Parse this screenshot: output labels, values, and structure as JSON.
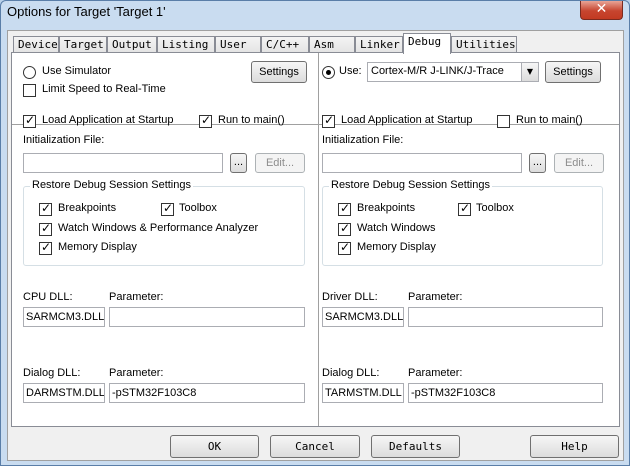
{
  "title": "Options for Target 'Target 1'",
  "close_glyph": "✕",
  "tabs": [
    "Device",
    "Target",
    "Output",
    "Listing",
    "User",
    "C/C++",
    "Asm",
    "Linker",
    "Debug",
    "Utilities"
  ],
  "active_tab": "Debug",
  "left": {
    "use_simulator": "Use Simulator",
    "use_simulator_selected": false,
    "settings": "Settings",
    "limit_speed": "Limit Speed to Real-Time",
    "limit_speed_checked": false,
    "load_app": "Load Application at Startup",
    "load_app_checked": true,
    "run_to_main": "Run to main()",
    "run_to_main_checked": true,
    "init_file_label": "Initialization File:",
    "init_file_value": "",
    "browse": "...",
    "edit": "Edit...",
    "restore_title": "Restore Debug Session Settings",
    "breakpoints": "Breakpoints",
    "toolbox": "Toolbox",
    "watch": "Watch Windows & Performance Analyzer",
    "memory": "Memory Display",
    "dll_label": "CPU DLL:",
    "param_label": "Parameter:",
    "dll_value": "SARMCM3.DLL",
    "dll_param": "",
    "dialog_dll_label": "Dialog DLL:",
    "dialog_param_label": "Parameter:",
    "dialog_dll_value": "DARMSTM.DLL",
    "dialog_param": "-pSTM32F103C8"
  },
  "right": {
    "use": "Use:",
    "use_selected": true,
    "driver": "Cortex-M/R J-LINK/J-Trace",
    "settings": "Settings",
    "load_app": "Load Application at Startup",
    "load_app_checked": true,
    "run_to_main": "Run to main()",
    "run_to_main_checked": false,
    "init_file_label": "Initialization File:",
    "init_file_value": "",
    "browse": "...",
    "edit": "Edit...",
    "restore_title": "Restore Debug Session Settings",
    "breakpoints": "Breakpoints",
    "toolbox": "Toolbox",
    "watch": "Watch Windows",
    "memory": "Memory Display",
    "dll_label": "Driver DLL:",
    "param_label": "Parameter:",
    "dll_value": "SARMCM3.DLL",
    "dll_param": "",
    "dialog_dll_label": "Dialog DLL:",
    "dialog_param_label": "Parameter:",
    "dialog_dll_value": "TARMSTM.DLL",
    "dialog_param": "-pSTM32F103C8"
  },
  "buttons": {
    "ok": "OK",
    "cancel": "Cancel",
    "defaults": "Defaults",
    "help": "Help"
  }
}
